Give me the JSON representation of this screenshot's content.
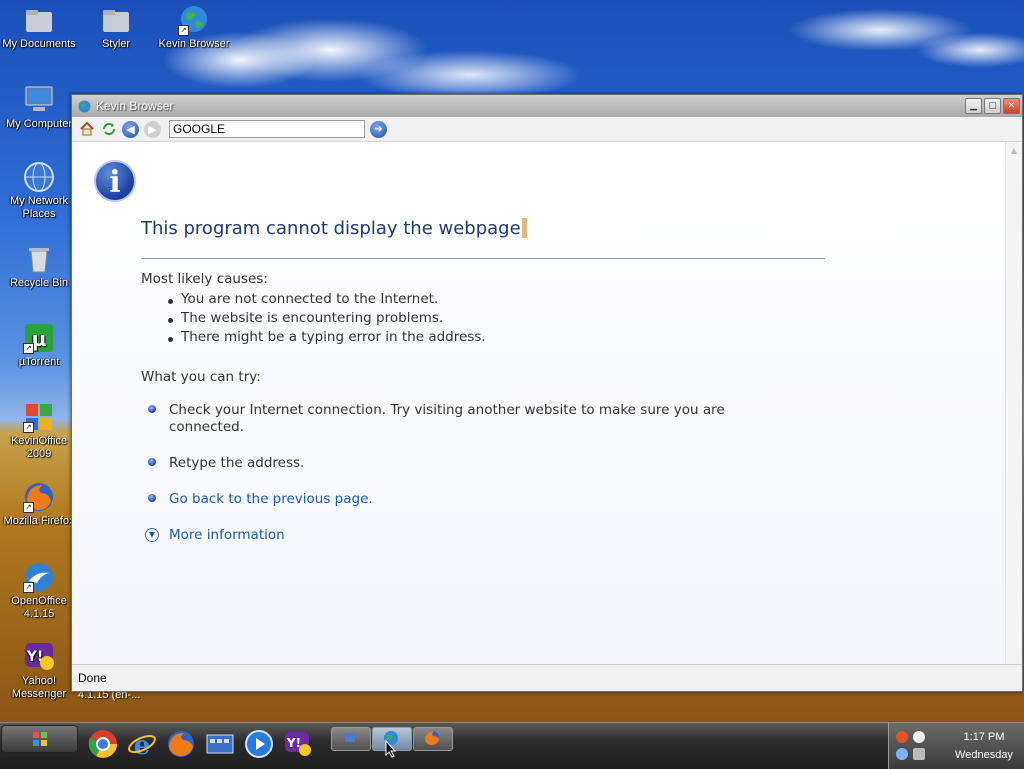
{
  "desktop": {
    "icons": [
      {
        "label": "My Documents"
      },
      {
        "label": "Styler"
      },
      {
        "label": "Kevin Browser"
      },
      {
        "label": "My Computer"
      },
      {
        "label": "My Network Places"
      },
      {
        "label": "Recycle Bin"
      },
      {
        "label": "µTorrent"
      },
      {
        "label": "KevinOffice 2009"
      },
      {
        "label": "Mozilla Firefox"
      },
      {
        "label": "OpenOffice 4.1.15"
      },
      {
        "label": "Yahoo! Messenger"
      }
    ],
    "partial_label": "4.1.15 (en-..."
  },
  "window": {
    "title": "Kevin Browser",
    "toolbar": {
      "home_icon": "home-icon",
      "refresh_icon": "refresh-icon",
      "back_icon": "back-arrow-icon",
      "forward_icon": "forward-arrow-icon",
      "address_value": "GOOGLE",
      "go_icon": "go-arrow-icon"
    },
    "status": "Done"
  },
  "error_page": {
    "title": "This program cannot display the webpage",
    "causes_heading": "Most likely causes:",
    "causes": [
      "You are not connected to the Internet.",
      "The website is encountering problems.",
      "There might be a typing error in the address."
    ],
    "try_heading": "What you can try:",
    "try_items": [
      "Check your Internet connection. Try visiting another website to make sure you are connected.",
      "Retype the address.",
      "Go back to the previous page."
    ],
    "more_info": "More information"
  },
  "taskbar": {
    "quick_launch": [
      "chrome-icon",
      "internet-explorer-icon",
      "firefox-icon",
      "window-switcher-icon",
      "media-player-icon",
      "yahoo-messenger-icon"
    ],
    "clock_time": "1:17 PM",
    "clock_day": "Wednesday"
  },
  "colors": {
    "title_text": "#1f3a6b",
    "link": "#1b5aa6",
    "body_text": "#333333"
  }
}
